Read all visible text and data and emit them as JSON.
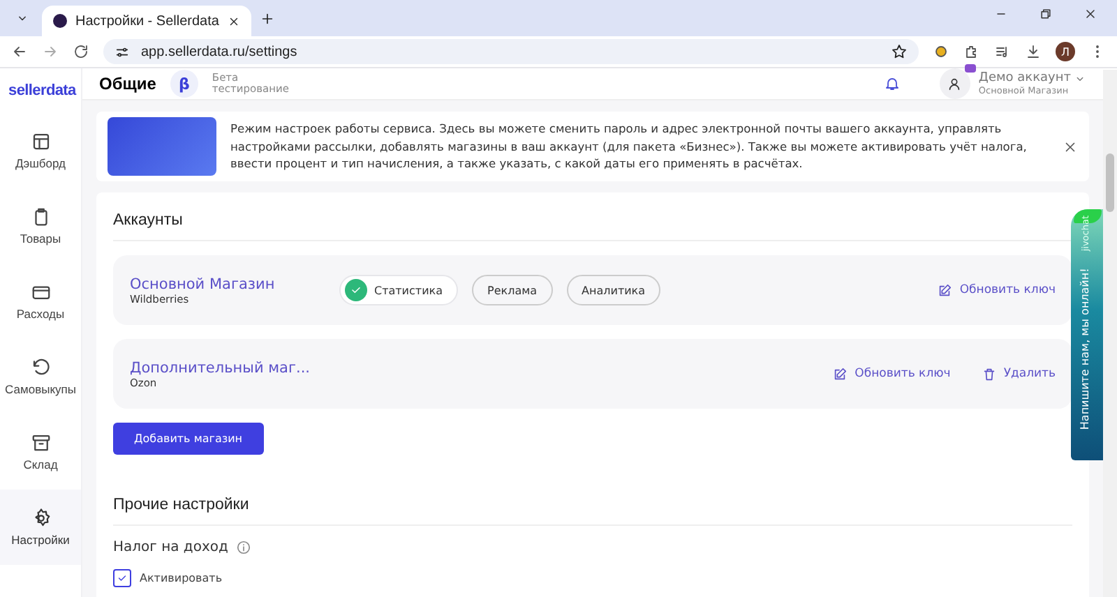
{
  "browser": {
    "tab_title": "Настройки - Sellerdata",
    "url": "app.sellerdata.ru/settings",
    "profile_initial": "Л"
  },
  "header": {
    "logo": "sellerdata",
    "page_title": "Общие",
    "beta_badge": "β",
    "beta_label": "Бета тестирование",
    "account_name": "Демо аккаунт",
    "account_shop": "Основной Магазин"
  },
  "sidebar": {
    "items": [
      {
        "label": "Дэшборд",
        "kind": "dashboard",
        "selected": false
      },
      {
        "label": "Товары",
        "kind": "clipboard",
        "selected": false
      },
      {
        "label": "Расходы",
        "kind": "card",
        "selected": false
      },
      {
        "label": "Самовыкупы",
        "kind": "undo",
        "selected": false
      },
      {
        "label": "Склад",
        "kind": "archive",
        "selected": false
      },
      {
        "label": "Настройки",
        "kind": "settings",
        "selected": true
      }
    ]
  },
  "banner": {
    "text": "Режим настроек работы сервиса. Здесь вы можете сменить пароль и адрес электронной почты вашего аккаунта, управлять настройками рассылки, добавлять магазины в ваш аккаунт (для пакета «Бизнес»). Также вы можете активировать учёт налога, ввести процент и тип начисления, а также указать, с какой даты его применять в расчётах."
  },
  "accounts": {
    "title": "Аккаунты",
    "shops": [
      {
        "name": "Основной Магазин",
        "marketplace": "Wildberries",
        "tags": [
          {
            "label": "Статистика",
            "checked": true
          },
          {
            "label": "Реклама",
            "checked": false
          },
          {
            "label": "Аналитика",
            "checked": false
          }
        ],
        "actions": [
          {
            "label": "Обновить ключ",
            "kind": "edit"
          }
        ]
      },
      {
        "name": "Дополнительный маг...",
        "marketplace": "Ozon",
        "actions": [
          {
            "label": "Обновить ключ",
            "kind": "edit"
          },
          {
            "label": "Удалить",
            "kind": "delete"
          }
        ]
      }
    ],
    "add_button": "Добавить магазин"
  },
  "other_settings": {
    "title": "Прочие настройки",
    "tax_label": "Налог на доход",
    "activate": {
      "label": "Активировать",
      "checked": true
    }
  },
  "chat_widget": {
    "brand": "jivochat",
    "text": "Напишите нам, мы онлайн!"
  }
}
